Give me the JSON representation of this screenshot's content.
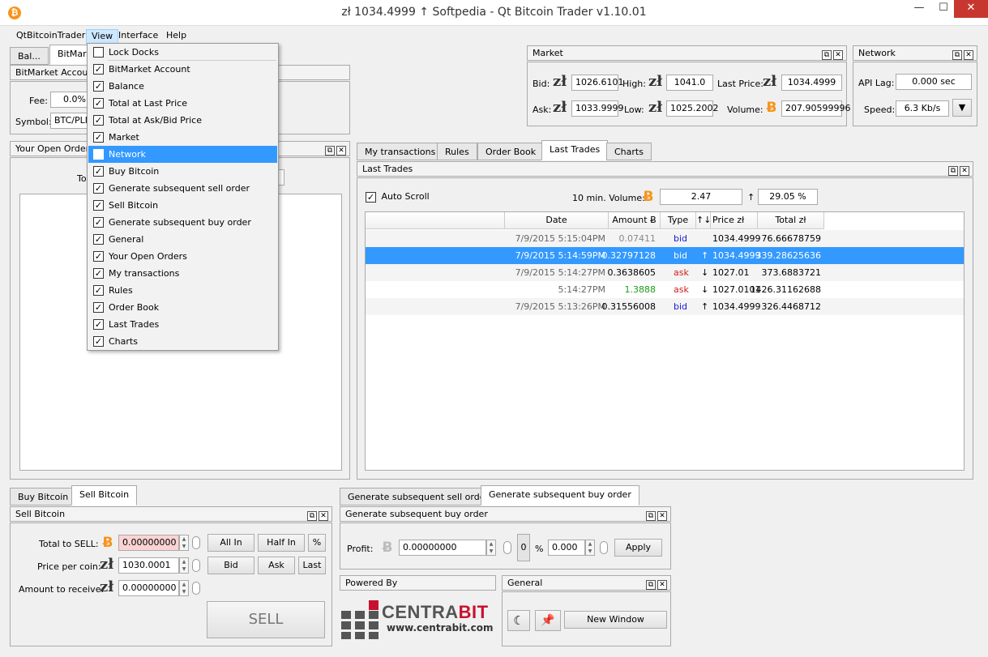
{
  "window": {
    "title": "zł 1034.4999 ↑ Softpedia - Qt Bitcoin Trader v1.10.01",
    "minimize": "—",
    "maximize": "☐",
    "close": "✕"
  },
  "menu": {
    "items": [
      "QtBitcoinTrader",
      "View",
      "Interface",
      "Help"
    ]
  },
  "left_tabs": [
    "Bal...",
    "BitMarket"
  ],
  "bitmarket_account": {
    "title": "BitMarket Account",
    "fee_label": "Fee:",
    "fee_value": "0.0%",
    "symbol_label": "Symbol:",
    "symbol_value": "BTC/PLN"
  },
  "open_orders": {
    "title": "Your Open Orders",
    "total_label": "To"
  },
  "view_menu": {
    "items": [
      {
        "label": "Lock Docks",
        "checked": false
      },
      {
        "label": "BitMarket Account",
        "checked": true
      },
      {
        "label": "Balance",
        "checked": true
      },
      {
        "label": "Total at Last Price",
        "checked": true
      },
      {
        "label": "Total at Ask/Bid Price",
        "checked": true
      },
      {
        "label": "Market",
        "checked": true
      },
      {
        "label": "Network",
        "checked": true,
        "highlighted": true
      },
      {
        "label": "Buy Bitcoin",
        "checked": true
      },
      {
        "label": "Generate subsequent sell order",
        "checked": true
      },
      {
        "label": "Sell Bitcoin",
        "checked": true
      },
      {
        "label": "Generate subsequent buy order",
        "checked": true
      },
      {
        "label": "General",
        "checked": true
      },
      {
        "label": "Your Open Orders",
        "checked": true
      },
      {
        "label": "My transactions",
        "checked": true
      },
      {
        "label": "Rules",
        "checked": true
      },
      {
        "label": "Order Book",
        "checked": true
      },
      {
        "label": "Last Trades",
        "checked": true
      },
      {
        "label": "Charts",
        "checked": true
      }
    ]
  },
  "market": {
    "title": "Market",
    "bid_label": "Bid:",
    "bid": "1026.6101",
    "high_label": "High:",
    "high": "1041.0",
    "last_label": "Last Price:",
    "last": "1034.4999",
    "ask_label": "Ask:",
    "ask": "1033.9999",
    "low_label": "Low:",
    "low": "1025.2002",
    "volume_label": "Volume:",
    "volume": "207.90599996"
  },
  "network": {
    "title": "Network",
    "api_lag_label": "API Lag:",
    "api_lag": "0.000 sec",
    "speed_label": "Speed:",
    "speed": "6.3 Kb/s"
  },
  "center_tabs": [
    "My transactions",
    "Rules",
    "Order Book",
    "Last Trades",
    "Charts"
  ],
  "last_trades": {
    "title": "Last Trades",
    "auto_scroll": "Auto Scroll",
    "volume_label": "10 min. Volume:",
    "volume": "2.47",
    "change_arrow": "↑",
    "change": "29.05 %",
    "columns": [
      "Date",
      "Amount Ƀ",
      "Type",
      "↑↓",
      "Price zł",
      "Total zł"
    ],
    "rows": [
      {
        "date": "7/9/2015 5:15:04PM",
        "amount": "0.07411",
        "type": "bid",
        "dir": "",
        "price": "1034.4999",
        "total": "76.66678759"
      },
      {
        "date": "7/9/2015 5:14:59PM",
        "amount": "0.32797128",
        "type": "bid",
        "dir": "↑",
        "price": "1034.4999",
        "total": "339.28625636"
      },
      {
        "date": "7/9/2015 5:14:27PM",
        "amount": "0.3638605",
        "type": "ask",
        "dir": "↓",
        "price": "1027.01",
        "total": "373.6883721"
      },
      {
        "date": "5:14:27PM",
        "amount": "1.3888",
        "type": "ask",
        "dir": "↓",
        "price": "1027.0101",
        "total": "1426.31162688"
      },
      {
        "date": "7/9/2015 5:13:26PM",
        "amount": "0.31556008",
        "type": "bid",
        "dir": "↑",
        "price": "1034.4999",
        "total": "326.4468712"
      }
    ]
  },
  "trade_tabs": [
    "Buy Bitcoin",
    "Sell Bitcoin"
  ],
  "sell": {
    "title": "Sell Bitcoin",
    "total_label": "Total to SELL:",
    "total": "0.00000000",
    "all_in": "All In",
    "half_in": "Half In",
    "pct": "%",
    "price_label": "Price per coin:",
    "price": "1030.0001",
    "bid_btn": "Bid",
    "ask_btn": "Ask",
    "last_btn": "Last",
    "receive_label": "Amount to receive:",
    "receive": "0.00000000",
    "sell_btn": "SELL"
  },
  "gen_tabs": [
    "Generate subsequent sell order",
    "Generate subsequent buy order"
  ],
  "gen_buy": {
    "title": "Generate subsequent buy order",
    "profit_label": "Profit:",
    "profit": "0.00000000",
    "zero": "0",
    "pct": "%",
    "pct_value": "0.000",
    "apply": "Apply"
  },
  "powered": {
    "title": "Powered By",
    "brand_a": "CENTRA",
    "brand_b": "BIT",
    "url": "www.centrabit.com"
  },
  "general": {
    "title": "General",
    "new_window": "New Window"
  },
  "icons": {
    "zloty": "zł",
    "bitcoin": "Ƀ",
    "restore": "⧉",
    "close": "✕"
  }
}
